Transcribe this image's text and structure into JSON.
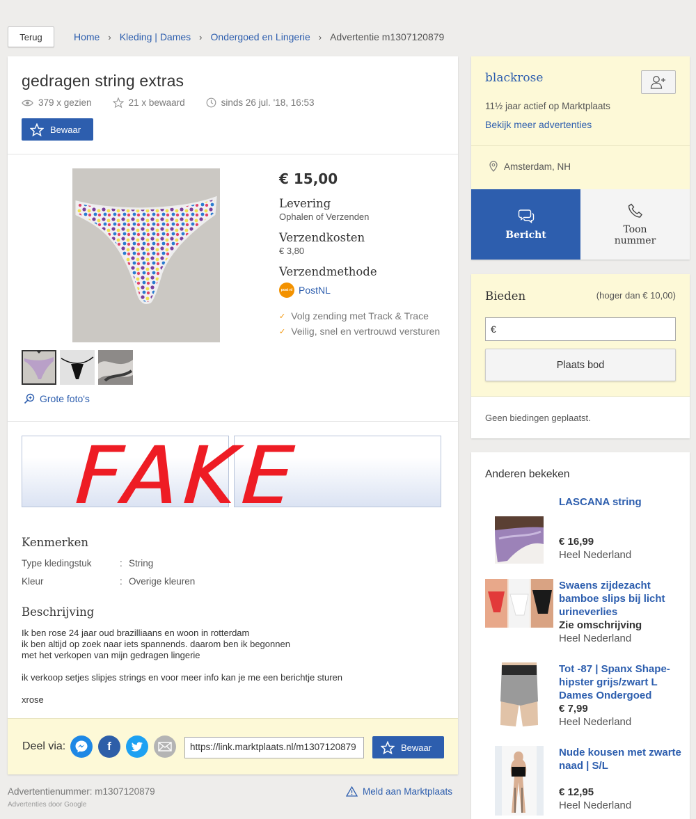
{
  "nav": {
    "back_label": "Terug",
    "breadcrumb": [
      "Home",
      "Kleding | Dames",
      "Ondergoed en Lingerie",
      "Advertentie m1307120879"
    ]
  },
  "ad": {
    "title": "gedragen string extras",
    "views": "379 x gezien",
    "saved": "21 x bewaard",
    "since": "sinds 26 jul. '18, 16:53",
    "save_label": "Bewaar",
    "price": "€ 15,00",
    "delivery_label": "Levering",
    "delivery_value": "Ophalen of Verzenden",
    "shipping_cost_label": "Verzendkosten",
    "shipping_cost_value": "€ 3,80",
    "shipping_method_label": "Verzendmethode",
    "shipping_method_value": "PostNL",
    "postnl_logo_text": "post nl",
    "checks": [
      "Volg zending met Track & Trace",
      "Veilig, snel en vertrouwd versturen"
    ],
    "large_photos_label": "Grote foto's",
    "banner_overlay": "FAKE",
    "features_title": "Kenmerken",
    "features": [
      {
        "key": "Type kledingstuk",
        "value": "String"
      },
      {
        "key": "Kleur",
        "value": "Overige kleuren"
      }
    ],
    "description_title": "Beschrijving",
    "description_lines": [
      "Ik ben rose 24 jaar oud brazilliaans en woon in rotterdam",
      "ik ben altijd op zoek naar iets spannends. daarom ben ik begonnen",
      "met het verkopen van mijn gedragen lingerie",
      "",
      "ik verkoop setjes slipjes strings en voor meer info kan je me een berichtje sturen",
      "",
      "xrose"
    ],
    "share_label": "Deel via:",
    "share_url": "https://link.marktplaats.nl/m1307120879",
    "ad_number": "Advertentienummer: m1307120879",
    "google_ads": "Advertenties door Google",
    "report_label": "Meld aan Marktplaats"
  },
  "seller": {
    "name": "blackrose",
    "active": "11½ jaar actief op Marktplaats",
    "more_ads": "Bekijk meer advertenties",
    "location": "Amsterdam, NH",
    "message_label": "Bericht",
    "call_label_1": "Toon",
    "call_label_2": "nummer"
  },
  "bid": {
    "title": "Bieden",
    "minimum": "(hoger dan € 10,00)",
    "input_prefix": "€",
    "button": "Plaats bod",
    "no_bids": "Geen biedingen geplaatst."
  },
  "others": {
    "title": "Anderen bekeken",
    "items": [
      {
        "title": "LASCANA string",
        "note": "",
        "price": "€ 16,99",
        "location": "Heel Nederland"
      },
      {
        "title": "Swaens zijdezacht bamboe slips bij licht urineverlies",
        "note": "Zie omschrijving",
        "price": "",
        "location": "Heel Nederland"
      },
      {
        "title": "Tot -87 | Spanx Shape-hipster grijs/zwart L Dames Ondergoed",
        "note": "",
        "price": "€ 7,99",
        "location": "Heel Nederland"
      },
      {
        "title": "Nude kousen met zwarte naad | S/L",
        "note": "",
        "price": "€ 12,95",
        "location": "Heel Nederland"
      }
    ]
  },
  "colors": {
    "brand_blue": "#2d5eae",
    "highlight_yellow": "#fdf9d7",
    "postnl_orange": "#f39200",
    "fake_red": "#ee1c24"
  }
}
